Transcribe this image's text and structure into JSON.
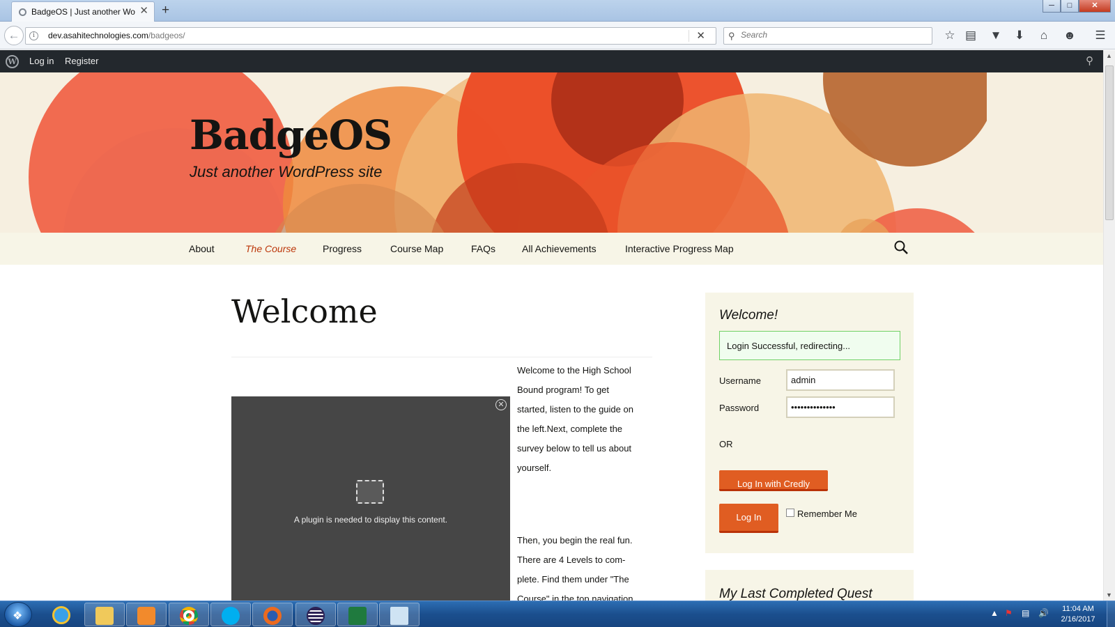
{
  "browser": {
    "tab_title": "BadgeOS | Just another Wo...",
    "url_domain": "dev.asahitechnologies.com",
    "url_path": "/badgeos/",
    "search_placeholder": "Search",
    "toolbar_icons": [
      "bookmark-star-icon",
      "reading-list-icon",
      "pocket-icon",
      "download-icon",
      "home-icon",
      "chat-icon",
      "menu-icon"
    ]
  },
  "admin_bar": {
    "login": "Log in",
    "register": "Register"
  },
  "site": {
    "title": "BadgeOS",
    "description": "Just another WordPress site"
  },
  "nav": {
    "items": [
      "About",
      "The Course",
      "Progress",
      "Course Map",
      "FAQs",
      "All Achievements",
      "Interactive Progress Map"
    ],
    "current": "The Course"
  },
  "page": {
    "title": "Welcome",
    "plugin_message": "A plugin is needed to display this content.",
    "para1": [
      "Welcome to the High School",
      "Bound program! To get",
      "started, listen to the guide on",
      "the left.Next, complete the",
      "survey below to tell us about",
      "yourself."
    ],
    "para2": [
      "Then, you begin the real fun.",
      "There are 4 Levels to com-",
      "plete. Find them under \"The",
      "Course\" in the top navigation"
    ]
  },
  "widget": {
    "title": "Welcome!",
    "success": "Login Successful, redirecting...",
    "username_label": "Username",
    "username_value": "admin",
    "password_label": "Password",
    "password_value": "••••••••••••••",
    "or": "OR",
    "credly_button": "Log In with Credly",
    "login_button": "Log In",
    "remember": "Remember Me"
  },
  "widget2": {
    "title": "My Last Completed Quest"
  },
  "taskbar": {
    "time": "11:04 AM",
    "date": "2/16/2017"
  },
  "colors": {
    "accent": "#bc360a",
    "button": "#e05d22",
    "admin_bar": "#23282d",
    "header_bg": "#f6efe0",
    "nav_bg": "#f7f5e7"
  }
}
